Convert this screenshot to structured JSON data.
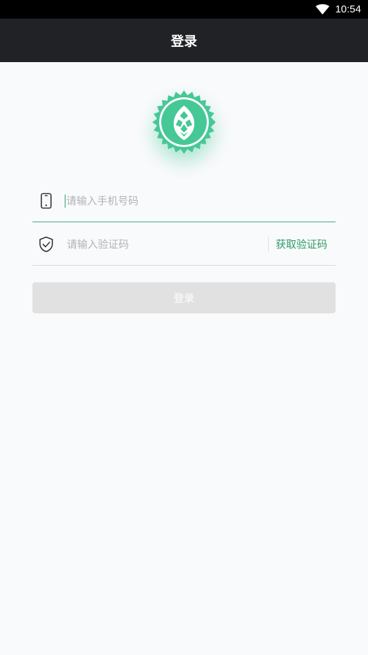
{
  "status_bar": {
    "time": "10:54",
    "wifi_icon": "wifi-icon"
  },
  "header": {
    "title": "登录"
  },
  "logo": {
    "icon": "hop-logo-icon",
    "color": "#46c896"
  },
  "phone_field": {
    "icon": "phone-icon",
    "placeholder": "请输入手机号码"
  },
  "code_field": {
    "icon": "shield-check-icon",
    "placeholder": "请输入验证码",
    "get_code_label": "获取验证码"
  },
  "login_button": {
    "label": "登录"
  },
  "colors": {
    "accent": "#2e9a66",
    "header_bg": "#212226",
    "button_disabled": "#e1e1e1"
  }
}
